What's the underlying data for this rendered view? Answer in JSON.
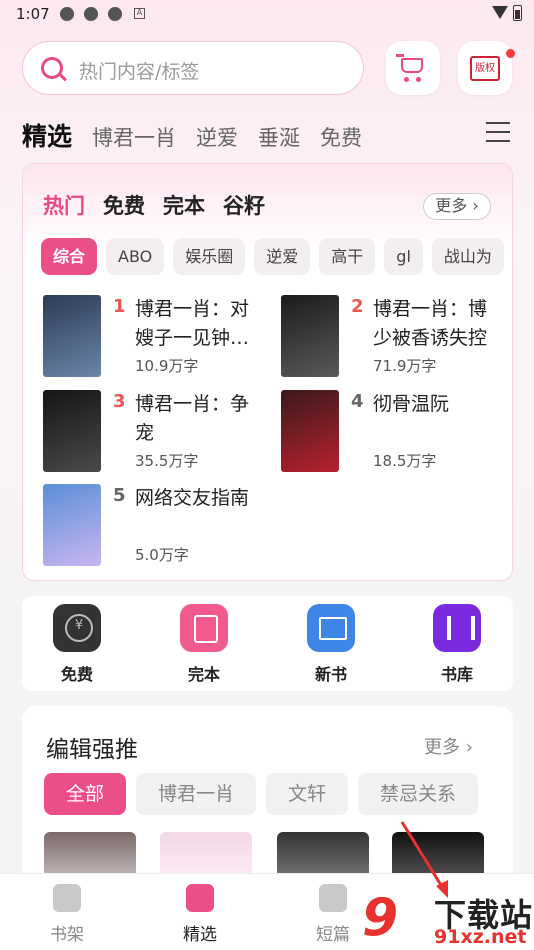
{
  "status": {
    "time": "1:07",
    "icon_letter": "A"
  },
  "search": {
    "placeholder": "热门内容/标签"
  },
  "header": {
    "copyright_label": "版权"
  },
  "tabs": [
    {
      "label": "精选",
      "active": true
    },
    {
      "label": "博君一肖"
    },
    {
      "label": "逆爱"
    },
    {
      "label": "垂涎"
    },
    {
      "label": "免费"
    }
  ],
  "hot": {
    "subtabs": [
      {
        "label": "热门",
        "active": true
      },
      {
        "label": "免费"
      },
      {
        "label": "完本"
      },
      {
        "label": "谷籽"
      }
    ],
    "more": "更多",
    "chips": [
      {
        "label": "综合",
        "active": true
      },
      {
        "label": "ABO"
      },
      {
        "label": "娱乐圈"
      },
      {
        "label": "逆爱"
      },
      {
        "label": "高干"
      },
      {
        "label": "gl"
      },
      {
        "label": "战山为"
      }
    ],
    "books": [
      {
        "rank": "1",
        "title": "博君一肖：对嫂子一见钟…",
        "count": "10.9万字"
      },
      {
        "rank": "2",
        "title": "博君一肖：博少被香诱失控",
        "count": "71.9万字"
      },
      {
        "rank": "3",
        "title": "博君一肖：争宠",
        "count": "35.5万字"
      },
      {
        "rank": "4",
        "title": "彻骨温阮",
        "count": "18.5万字"
      },
      {
        "rank": "5",
        "title": "网络交友指南",
        "count": "5.0万字"
      }
    ]
  },
  "quick": [
    {
      "label": "免费",
      "icon": "coin-icon"
    },
    {
      "label": "完本",
      "icon": "check-doc-icon"
    },
    {
      "label": "新书",
      "icon": "book-open-icon"
    },
    {
      "label": "书库",
      "icon": "library-icon"
    }
  ],
  "editor": {
    "title": "编辑强推",
    "more": "更多",
    "chips": [
      {
        "label": "全部",
        "active": true
      },
      {
        "label": "博君一肖"
      },
      {
        "label": "文轩"
      },
      {
        "label": "禁忌关系"
      }
    ]
  },
  "bottom_nav": [
    {
      "label": "书架"
    },
    {
      "label": "精选",
      "active": true
    },
    {
      "label": "短篇"
    }
  ],
  "watermark": {
    "mark": "9",
    "name": "下载站",
    "url": "91xz.net"
  },
  "colors": {
    "accent": "#ec4f88",
    "rank_red": "#e8584e"
  }
}
